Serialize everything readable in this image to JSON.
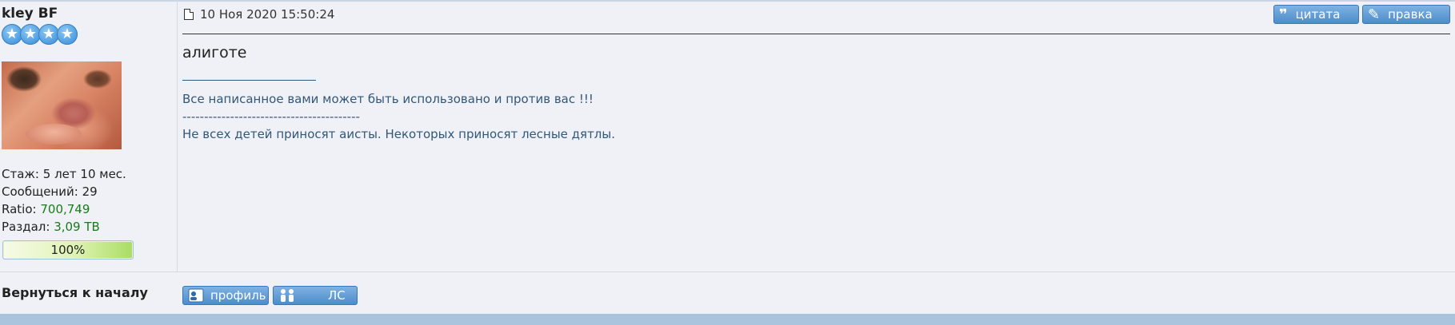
{
  "user": {
    "name": "kley BF",
    "stars": 4,
    "stats": {
      "experience_label": "Стаж:",
      "experience_value": "5 лет 10 мес.",
      "posts_label": "Сообщений:",
      "posts_value": "29",
      "ratio_label": "Ratio:",
      "ratio_value": "700,749",
      "upload_label": "Раздал:",
      "upload_value": "3,09 TB"
    },
    "progress_text": "100%",
    "progress_value": 1.0
  },
  "post": {
    "date": "10 Ноя 2020 15:50:24",
    "body": "алиготе",
    "signature": {
      "line1": "Все написанное вами может быть использовано и против вас !!!",
      "line2": "-----------------------------------------",
      "line3": "Не всех детей приносят аисты. Некоторых приносят лесные дятлы."
    }
  },
  "buttons": {
    "quote": "цитата",
    "edit": "правка",
    "profile": "профиль",
    "pm": "ЛС"
  },
  "footer": {
    "back_to_top": "Вернуться к началу"
  },
  "colors": {
    "background": "#eff1f6",
    "button": "#5f9ad6",
    "signature": "#335777",
    "ratio_green": "#1a7a1a"
  },
  "icons": [
    "document-icon",
    "quote-icon",
    "pencil-icon",
    "profile-card-icon",
    "people-icon",
    "star-icon"
  ]
}
